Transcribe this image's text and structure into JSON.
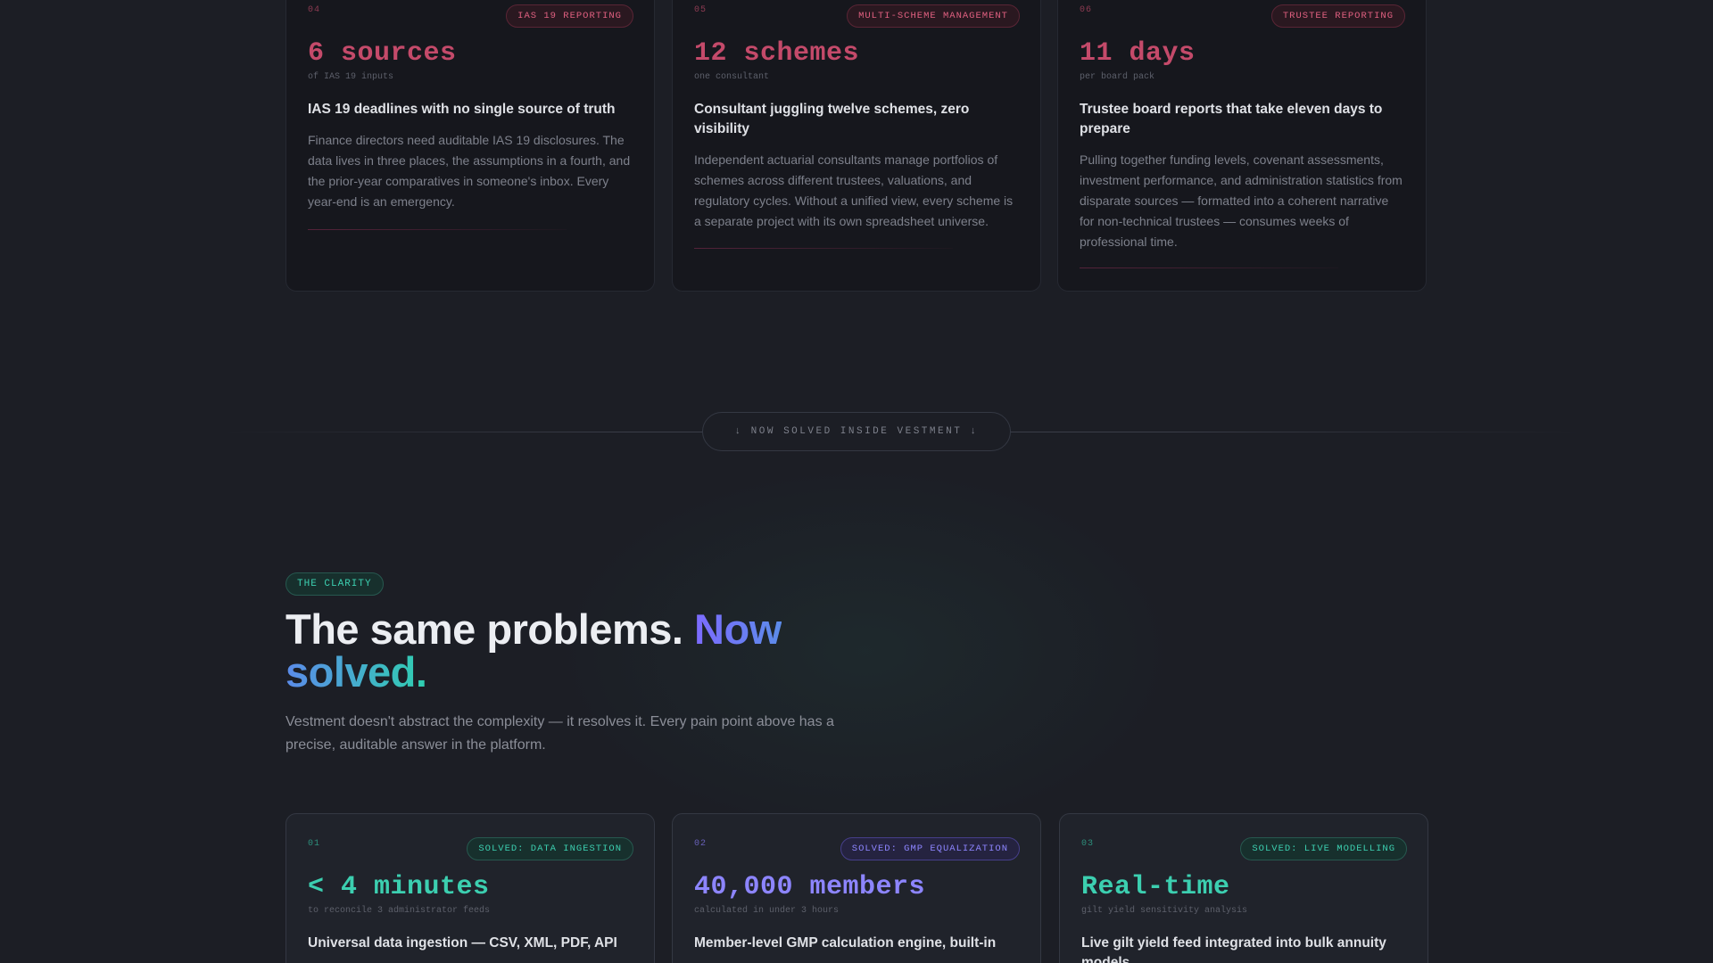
{
  "top_cards": [
    {
      "num": "04",
      "tag": "IAS 19 REPORTING",
      "metric": "6 sources",
      "metric_sub": "of IAS 19 inputs",
      "title": "IAS 19 deadlines with no single source of truth",
      "desc": "Finance directors need auditable IAS 19 disclosures. The data lives in three places, the assumptions in a fourth, and the prior-year comparatives in someone's inbox. Every year-end is an emergency."
    },
    {
      "num": "05",
      "tag": "MULTI-SCHEME MANAGEMENT",
      "metric": "12 schemes",
      "metric_sub": "one consultant",
      "title": "Consultant juggling twelve schemes, zero visibility",
      "desc": "Independent actuarial consultants manage portfolios of schemes across different trustees, valuations, and regulatory cycles. Without a unified view, every scheme is a separate project with its own spreadsheet universe."
    },
    {
      "num": "06",
      "tag": "TRUSTEE REPORTING",
      "metric": "11 days",
      "metric_sub": "per board pack",
      "title": "Trustee board reports that take eleven days to prepare",
      "desc": "Pulling together funding levels, covenant assessments, investment performance, and administration statistics from disparate sources — formatted into a coherent narrative for non-technical trustees — consumes weeks of professional time."
    }
  ],
  "divider": {
    "label": "↓ NOW SOLVED INSIDE VESTMENT ↓"
  },
  "clarity": {
    "badge": "THE CLARITY",
    "headline_main": "The same problems. ",
    "headline_accent": "Now solved.",
    "lead": "Vestment doesn't abstract the complexity — it resolves it. Every pain point above has a precise, auditable answer in the platform."
  },
  "bottom_cards": [
    {
      "num": "01",
      "tag": "SOLVED: DATA INGESTION",
      "metric": "< 4 minutes",
      "metric_sub": "to reconcile 3 administrator feeds",
      "title": "Universal data ingestion — CSV, XML, PDF, API",
      "color": "#3ccfb0"
    },
    {
      "num": "02",
      "tag": "SOLVED: GMP EQUALIZATION",
      "metric": "40,000 members",
      "metric_sub": "calculated in under 3 hours",
      "title": "Member-level GMP calculation engine, built-in",
      "color": "#8d85ff"
    },
    {
      "num": "03",
      "tag": "SOLVED: LIVE MODELLING",
      "metric": "Real-time",
      "metric_sub": "gilt yield sensitivity analysis",
      "title": "Live gilt yield feed integrated into bulk annuity models",
      "color": "#3ccfb0"
    }
  ],
  "colors": {
    "background": "#1c1e25",
    "problem_accent": "#c44a6a",
    "solved_teal": "#3ccfb0",
    "solved_purple": "#8d85ff"
  }
}
